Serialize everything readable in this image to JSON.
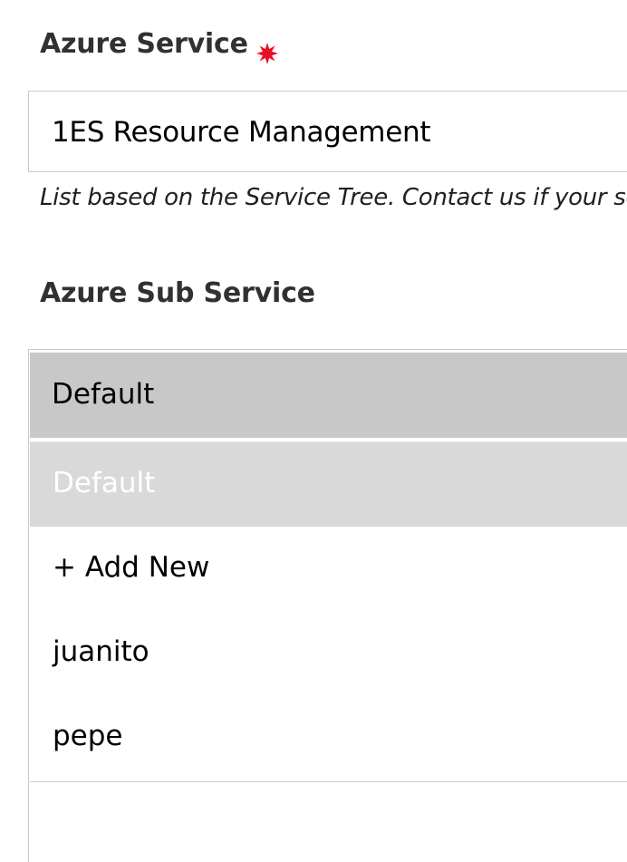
{
  "azure_service": {
    "label": "Azure Service",
    "value": "1ES Resource Management",
    "helper_text": "List based on the Service Tree. Contact us if your se",
    "required_color": "#e81123"
  },
  "azure_sub_service": {
    "label": "Azure Sub Service",
    "selected_value": "Default",
    "options": [
      {
        "label": "Default",
        "highlighted": true
      },
      {
        "label": "+ Add New"
      },
      {
        "label": "juanito"
      },
      {
        "label": "pepe"
      }
    ]
  },
  "colors": {
    "label_text": "#323130",
    "border": "#c8c8c8",
    "select_background": "#c8c8c8",
    "highlight_background": "#d9d9d9"
  }
}
